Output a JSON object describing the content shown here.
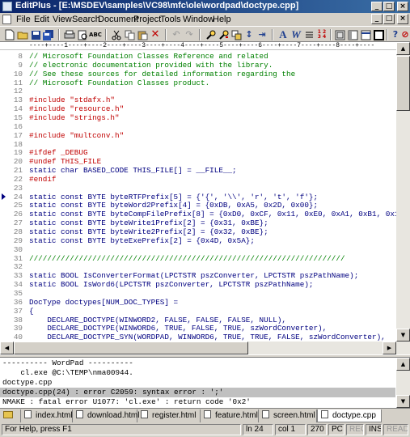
{
  "window": {
    "title": "EditPlus - [E:\\MSDEV\\samples\\VC98\\mfc\\ole\\wordpad\\doctype.cpp]",
    "minimize": "_",
    "maximize": "□",
    "close": "×"
  },
  "menu": {
    "items": [
      "File",
      "Edit",
      "View",
      "Search",
      "Document",
      "Project",
      "Tools",
      "Window",
      "Help"
    ]
  },
  "toolbar": {
    "icons": [
      "new-file-icon",
      "open-icon",
      "save-icon",
      "save-all-icon",
      "print-icon",
      "print-preview-icon",
      "spellcheck-icon",
      "cut-icon",
      "copy-icon",
      "paste-icon",
      "delete-icon",
      "undo-icon",
      "redo-icon",
      "find-icon",
      "find-next-icon",
      "replace-icon",
      "go-to-icon",
      "find-in-files-icon",
      "font-icon",
      "word-wrap-icon",
      "line-number-icon",
      "ruler-icon",
      "column-icon",
      "toggle-icon",
      "browser-icon",
      "fullscreen-icon",
      "help-icon",
      "context-help-icon"
    ],
    "glyphs": {
      "spellcheck": "ABC",
      "fonts": "A",
      "linenum": "1 2\n3 4"
    }
  },
  "ruler": {
    "text": "----+----1----+----2----+----3----+----4----+----5----+----6----+----7----+----8----+----"
  },
  "editor": {
    "lines": [
      {
        "n": "8",
        "t": "// Microsoft Foundation Classes Reference and related",
        "k": "comment"
      },
      {
        "n": "9",
        "t": "// electronic documentation provided with the library.",
        "k": "comment"
      },
      {
        "n": "10",
        "t": "// See these sources for detailed information regarding the",
        "k": "comment"
      },
      {
        "n": "11",
        "t": "// Microsoft Foundation Classes product.",
        "k": "comment"
      },
      {
        "n": "12",
        "t": "",
        "k": "code"
      },
      {
        "n": "13",
        "t": "#include \"stdafx.h\"",
        "k": "pre"
      },
      {
        "n": "14",
        "t": "#include \"resource.h\"",
        "k": "pre"
      },
      {
        "n": "15",
        "t": "#include \"strings.h\"",
        "k": "pre"
      },
      {
        "n": "16",
        "t": "",
        "k": "code"
      },
      {
        "n": "17",
        "t": "#include \"multconv.h\"",
        "k": "pre"
      },
      {
        "n": "18",
        "t": "",
        "k": "code"
      },
      {
        "n": "19",
        "t": "#ifdef _DEBUG",
        "k": "pre"
      },
      {
        "n": "20",
        "t": "#undef THIS_FILE",
        "k": "pre"
      },
      {
        "n": "21",
        "t": "static char BASED_CODE THIS_FILE[] = __FILE__;",
        "k": "code"
      },
      {
        "n": "22",
        "t": "#endif",
        "k": "pre"
      },
      {
        "n": "23",
        "t": "",
        "k": "code"
      },
      {
        "n": "24",
        "t": "static const BYTE byteRTFPrefix[5] = {'{', '\\\\', 'r', 't', 'f'};",
        "k": "code"
      },
      {
        "n": "25",
        "t": "static const BYTE byteWord2Prefix[4] = {0xDB, 0xA5, 0x2D, 0x00};",
        "k": "code"
      },
      {
        "n": "26",
        "t": "static const BYTE byteCompFilePrefix[8] = {0xD0, 0xCF, 0x11, 0xE0, 0xA1, 0xB1, 0x1A, 0xE1",
        "k": "code"
      },
      {
        "n": "27",
        "t": "static const BYTE byteWrite1Prefix[2] = {0x31, 0xBE};",
        "k": "code"
      },
      {
        "n": "28",
        "t": "static const BYTE byteWrite2Prefix[2] = {0x32, 0xBE};",
        "k": "code"
      },
      {
        "n": "29",
        "t": "static const BYTE byteExePrefix[2] = {0x4D, 0x5A};",
        "k": "code"
      },
      {
        "n": "30",
        "t": "",
        "k": "code"
      },
      {
        "n": "31",
        "t": "//////////////////////////////////////////////////////////////////////",
        "k": "comment"
      },
      {
        "n": "32",
        "t": "",
        "k": "code"
      },
      {
        "n": "33",
        "t": "static BOOL IsConverterFormat(LPCTSTR pszConverter, LPCTSTR pszPathName);",
        "k": "code"
      },
      {
        "n": "34",
        "t": "static BOOL IsWord6(LPCTSTR pszConverter, LPCTSTR pszPathName);",
        "k": "code"
      },
      {
        "n": "35",
        "t": "",
        "k": "code"
      },
      {
        "n": "36",
        "t": "DocType doctypes[NUM_DOC_TYPES] =",
        "k": "code"
      },
      {
        "n": "37",
        "t": "{",
        "k": "code"
      },
      {
        "n": "38",
        "t": "    DECLARE_DOCTYPE(WINWORD2, FALSE, FALSE, FALSE, NULL),",
        "k": "code"
      },
      {
        "n": "39",
        "t": "    DECLARE_DOCTYPE(WINWORD6, TRUE, FALSE, TRUE, szWordConverter),",
        "k": "code"
      },
      {
        "n": "40",
        "t": "    DECLARE_DOCTYPE_SYN(WORDPAD, WINWORD6, TRUE, TRUE, FALSE, szWordConverter),",
        "k": "code"
      }
    ]
  },
  "output": {
    "lines": [
      {
        "t": "---------- WordPad ----------",
        "hl": false
      },
      {
        "t": "    cl.exe @C:\\TEMP\\nma00944.",
        "hl": false
      },
      {
        "t": "doctype.cpp",
        "hl": false
      },
      {
        "t": "doctype.cpp(24) : error C2059: syntax error : ';'",
        "hl": true
      },
      {
        "t": "NMAKE : fatal error U1077: 'cl.exe' : return code '0x2'",
        "hl": false
      }
    ]
  },
  "tabs": [
    "index.html",
    "download.html",
    "register.html",
    "feature.html",
    "screen.html",
    "doctype.cpp"
  ],
  "status": {
    "help": "For Help, press F1",
    "line": "ln 24",
    "col": "col 1",
    "count": "270",
    "mode": "PC",
    "rec": "REC",
    "ins": "INS",
    "read": "READ"
  },
  "colors": {
    "comment": "#008000",
    "code": "#000080",
    "preprocessor": "#c00000",
    "titlebar": "#0a246a"
  }
}
